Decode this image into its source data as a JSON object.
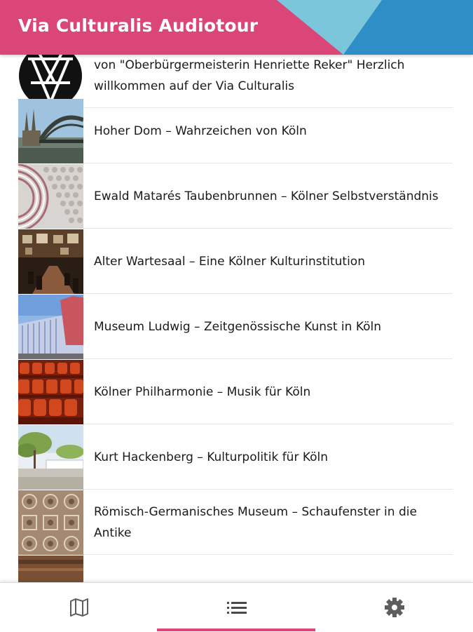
{
  "app": {
    "title": "Via Culturalis Audiotour"
  },
  "colors": {
    "accent": "#d94677",
    "light_blue": "#7cc6dc",
    "blue": "#2f8ec6"
  },
  "list": {
    "items": [
      {
        "label": "von \"Oberbürgermeisterin Henriette Reker\" Herzlich willkommen auf der Via Culturalis",
        "thumb": "via-culturalis-logo"
      },
      {
        "label": "Hoher Dom – Wahrzeichen von Köln",
        "thumb": "cathedral-photo"
      },
      {
        "label": "Ewald Matarés Taubenbrunnen – Kölner Selbstverständnis",
        "thumb": "fountain-photo"
      },
      {
        "label": "Alter Wartesaal – Eine Kölner Kulturinstitution",
        "thumb": "hall-photo"
      },
      {
        "label": "Museum Ludwig – Zeitgenössische Kunst in Köln",
        "thumb": "museum-photo"
      },
      {
        "label": "Kölner Philharmonie – Musik für Köln",
        "thumb": "concert-seats-photo"
      },
      {
        "label": "Kurt Hackenberg – Kulturpolitik für Köln",
        "thumb": "plaza-photo"
      },
      {
        "label": "Römisch-Germanisches Museum – Schaufenster in die Antike",
        "thumb": "mosaic-photo"
      },
      {
        "label": "",
        "thumb": "partial-photo"
      }
    ]
  },
  "nav": {
    "items": [
      {
        "icon": "map-icon",
        "active": false
      },
      {
        "icon": "list-icon",
        "active": true
      },
      {
        "icon": "gear-icon",
        "active": false
      }
    ]
  }
}
